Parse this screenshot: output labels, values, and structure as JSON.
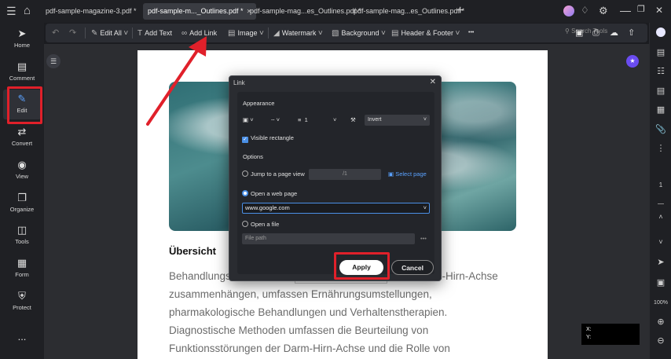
{
  "tabs": [
    {
      "label": "pdf-sample-magazine-3.pdf *",
      "active": false
    },
    {
      "label": "pdf-sample-m..._Outlines.pdf *",
      "active": true
    },
    {
      "label": "pdf-sample-mag...es_Outlines.pdf *",
      "active": false
    },
    {
      "label": "pdf-sample-mag...es_Outlines.pdf *",
      "active": false
    }
  ],
  "titlebar_icons": [
    "menu-icon",
    "home-icon",
    "plus-icon",
    "avatar",
    "bell-icon",
    "gear-icon",
    "minimize-icon",
    "restore-icon",
    "close-icon"
  ],
  "sidebar": {
    "items": [
      {
        "label": "Home",
        "icon": "rocket-icon"
      },
      {
        "label": "Comment",
        "icon": "comment-icon"
      },
      {
        "label": "Edit",
        "icon": "edit-icon",
        "active": true
      },
      {
        "label": "Convert",
        "icon": "convert-icon"
      },
      {
        "label": "View",
        "icon": "eye-icon"
      },
      {
        "label": "Organize",
        "icon": "organize-icon"
      },
      {
        "label": "Tools",
        "icon": "toolbox-icon"
      },
      {
        "label": "Form",
        "icon": "form-icon"
      },
      {
        "label": "Protect",
        "icon": "shield-icon"
      }
    ],
    "more": "..."
  },
  "toolbar": {
    "edit_all": "Edit All",
    "add_text": "Add Text",
    "add_link": "Add Link",
    "image": "Image",
    "watermark": "Watermark",
    "background": "Background",
    "header_footer": "Header & Footer",
    "more": "•••",
    "search_placeholder": "Search Tools"
  },
  "document": {
    "heading": "Übersicht",
    "lines": [
      "Behandlungs",
      "zusammenhängen, umfassen Ernährungsumstellungen,",
      "pharmakologische Behandlungen und Verhaltenstherapien.",
      "Diagnostische Methoden umfassen die Beurteilung von",
      "Funktionsstörungen der Darm-Hirn-Achse und die Rolle von"
    ],
    "line0_tail": "n-Hirn-Achse"
  },
  "dialog": {
    "title": "Link",
    "appearance": "Appearance",
    "line_width": "1",
    "highlight": "Invert",
    "visible_rectangle": "Visible rectangle",
    "options": "Options",
    "jump_to_page": "Jump to a page view",
    "page_of": "/1",
    "select_page": "Select page",
    "open_web_page": "Open a web page",
    "url": "www.google.com",
    "open_file": "Open a file",
    "file_path_placeholder": "File path",
    "apply": "Apply",
    "cancel": "Cancel"
  },
  "right_rail": {
    "page_number": "1",
    "zoom": "100%"
  },
  "coords": {
    "x": "X:",
    "y": "Y:"
  },
  "colors": {
    "accent": "#4a8fe6",
    "highlight_red": "#e0202a",
    "active_icon": "#5aa2ff"
  }
}
